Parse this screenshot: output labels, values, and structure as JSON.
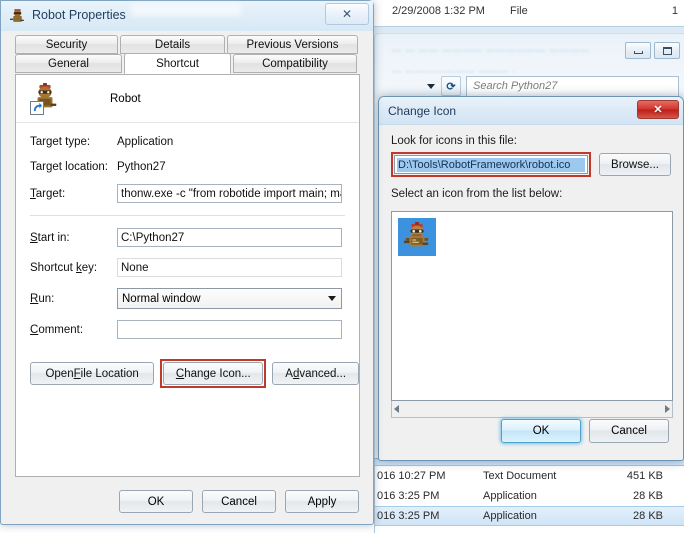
{
  "explorer": {
    "header_row": {
      "date": "2/29/2008 1:32 PM",
      "type": "File",
      "size": "1"
    },
    "search_placeholder": "Search Python27",
    "minimize_label": "minimize",
    "maximize_label": "maximize",
    "refresh_label": "refresh",
    "file_rows": [
      {
        "date": "016 10:27 PM",
        "type": "Text Document",
        "size": "451 KB",
        "selected": false
      },
      {
        "date": "016 3:25 PM",
        "type": "Application",
        "size": "28 KB",
        "selected": false
      },
      {
        "date": "016 3:25 PM",
        "type": "Application",
        "size": "28 KB",
        "selected": true
      }
    ]
  },
  "properties": {
    "title": "Robot Properties",
    "close_label": "✕",
    "tabs_row1": [
      {
        "label": "Security",
        "active": false
      },
      {
        "label": "Details",
        "active": false
      },
      {
        "label": "Previous Versions",
        "active": false
      }
    ],
    "tabs_row2": [
      {
        "label": "General",
        "active": false
      },
      {
        "label": "Shortcut",
        "active": true
      },
      {
        "label": "Compatibility",
        "active": false
      }
    ],
    "shortcut_name": "Robot",
    "fields": {
      "target_type_label": "Target type:",
      "target_type_value": "Application",
      "target_location_label": "Target location:",
      "target_location_value": "Python27",
      "target_label": "Target:",
      "target_value": "thonw.exe -c \"from robotide import main; main();\"",
      "start_in_label": "Start in:",
      "start_in_value": "C:\\Python27",
      "shortcut_key_label": "Shortcut key:",
      "shortcut_key_value": "None",
      "run_label": "Run:",
      "run_value": "Normal window",
      "comment_label": "Comment:",
      "comment_value": ""
    },
    "buttons": {
      "open_file_location": "Open File Location",
      "change_icon": "Change Icon...",
      "advanced": "Advanced..."
    },
    "footer": {
      "ok": "OK",
      "cancel": "Cancel",
      "apply": "Apply"
    }
  },
  "change_icon": {
    "title": "Change Icon",
    "close_label": "✕",
    "look_for_label": "Look for icons in this file:",
    "path_value": "D:\\Tools\\RobotFramework\\robot.ico",
    "browse_label": "Browse...",
    "select_icon_label": "Select an icon from the list below:",
    "footer": {
      "ok": "OK",
      "cancel": "Cancel"
    }
  },
  "colors": {
    "highlight_red": "#c0392b",
    "selection_blue": "#9dc8ef",
    "icon_cell_blue": "#3c92df",
    "focus_glow": "#50b4e6"
  }
}
